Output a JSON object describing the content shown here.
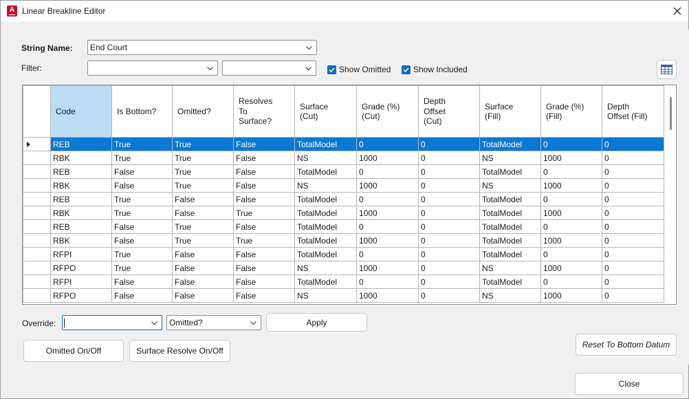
{
  "window": {
    "title": "Linear Breakline Editor",
    "app_icon_letter": "A"
  },
  "form": {
    "string_name_label": "String Name:",
    "string_name_value": "End Court",
    "filter_label": "Filter:",
    "filter1_value": "",
    "filter2_value": "",
    "show_omitted_label": "Show Omitted",
    "show_omitted_checked": true,
    "show_included_label": "Show Included",
    "show_included_checked": true
  },
  "table": {
    "columns": [
      [
        "Code"
      ],
      [
        "Is Bottom?"
      ],
      [
        "Omitted?"
      ],
      [
        "Resolves",
        "To",
        "Surface?"
      ],
      [
        "Surface",
        "(Cut)"
      ],
      [
        "Grade (%)",
        "(Cut)"
      ],
      [
        "Depth",
        "Offset",
        "(Cut)"
      ],
      [
        "Surface",
        "(Fill)"
      ],
      [
        "Grade (%)",
        "(Fill)"
      ],
      [
        "Depth",
        "Offset (Fill)"
      ]
    ],
    "selected_row": 0,
    "rows": [
      [
        "REB",
        "True",
        "True",
        "False",
        "TotalModel",
        "0",
        "0",
        "TotalModel",
        "0",
        "0"
      ],
      [
        "RBK",
        "True",
        "True",
        "False",
        "NS",
        "1000",
        "0",
        "NS",
        "1000",
        "0"
      ],
      [
        "REB",
        "False",
        "True",
        "False",
        "TotalModel",
        "0",
        "0",
        "TotalModel",
        "0",
        "0"
      ],
      [
        "RBK",
        "False",
        "True",
        "False",
        "NS",
        "1000",
        "0",
        "NS",
        "1000",
        "0"
      ],
      [
        "REB",
        "True",
        "False",
        "False",
        "TotalModel",
        "0",
        "0",
        "TotalModel",
        "0",
        "0"
      ],
      [
        "RBK",
        "True",
        "False",
        "True",
        "TotalModel",
        "1000",
        "0",
        "TotalModel",
        "1000",
        "0"
      ],
      [
        "REB",
        "False",
        "True",
        "False",
        "TotalModel",
        "0",
        "0",
        "TotalModel",
        "0",
        "0"
      ],
      [
        "RBK",
        "False",
        "True",
        "True",
        "TotalModel",
        "1000",
        "0",
        "TotalModel",
        "1000",
        "0"
      ],
      [
        "RFPI",
        "True",
        "False",
        "False",
        "TotalModel",
        "0",
        "0",
        "TotalModel",
        "0",
        "0"
      ],
      [
        "RFPO",
        "True",
        "False",
        "False",
        "NS",
        "1000",
        "0",
        "NS",
        "1000",
        "0"
      ],
      [
        "RFPI",
        "False",
        "False",
        "False",
        "TotalModel",
        "0",
        "0",
        "TotalModel",
        "0",
        "0"
      ],
      [
        "RFPO",
        "False",
        "False",
        "False",
        "NS",
        "1000",
        "0",
        "NS",
        "1000",
        "0"
      ]
    ]
  },
  "override": {
    "label": "Override:",
    "value_combo": "",
    "field_combo": "Omitted?",
    "apply_label": "Apply"
  },
  "buttons": {
    "omitted_toggle": "Omitted On/Off",
    "surface_resolve_toggle": "Surface Resolve On/Off",
    "reset_bottom_datum": "Reset To Bottom Datum",
    "close": "Close"
  },
  "colors": {
    "selection": "#0b78d4",
    "header_highlight": "#bcdcf4",
    "checkbox": "#0f6cbd",
    "app_icon": "#c8102e"
  }
}
